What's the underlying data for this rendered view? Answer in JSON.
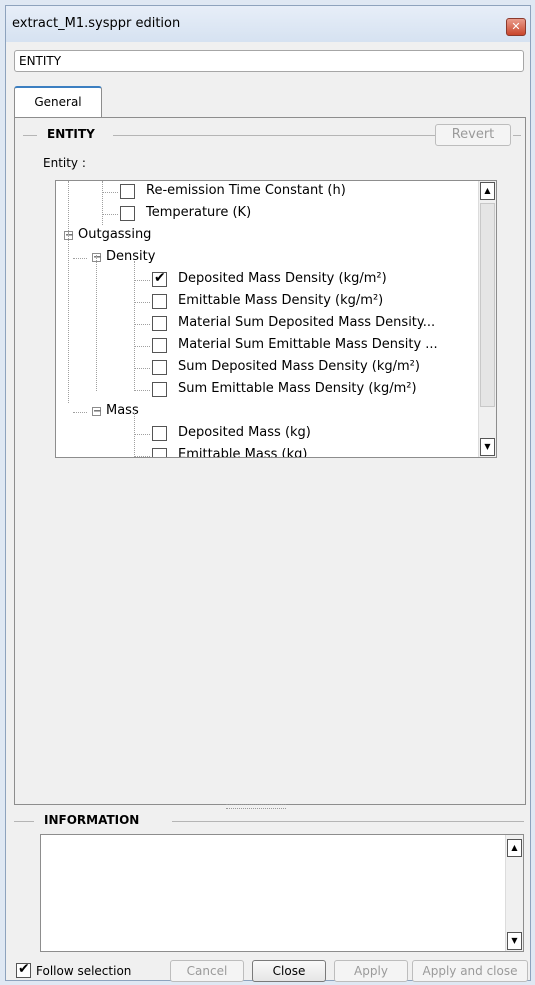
{
  "window": {
    "title": "extract_M1.sysppr edition",
    "close_glyph": "✕"
  },
  "entity_field": {
    "value": "ENTITY"
  },
  "tabs": [
    {
      "label": "General",
      "active": true
    }
  ],
  "entity_group": {
    "title": "ENTITY",
    "revert_label": "Revert",
    "entity_label": "Entity :",
    "tree": [
      {
        "label": "Re-emission Time Constant (h)",
        "type": "leaf",
        "checked": false
      },
      {
        "label": "Temperature (K)",
        "type": "leaf",
        "checked": false
      },
      {
        "label": "Outgassing",
        "type": "node",
        "expanded": true
      },
      {
        "label": "Density",
        "type": "node",
        "expanded": true
      },
      {
        "label": "Deposited Mass Density (kg/m²)",
        "type": "leaf",
        "checked": true
      },
      {
        "label": "Emittable Mass Density (kg/m²)",
        "type": "leaf",
        "checked": false
      },
      {
        "label": "Material Sum Deposited Mass Density...",
        "type": "leaf",
        "checked": false
      },
      {
        "label": "Material Sum Emittable Mass Density ...",
        "type": "leaf",
        "checked": false
      },
      {
        "label": "Sum Deposited Mass Density (kg/m²)",
        "type": "leaf",
        "checked": false
      },
      {
        "label": "Sum Emittable Mass Density (kg/m²)",
        "type": "leaf",
        "checked": false
      },
      {
        "label": "Mass",
        "type": "node",
        "expanded": true
      },
      {
        "label": "Deposited Mass (kg)",
        "type": "leaf",
        "checked": false
      },
      {
        "label": "Emittable Mass (kg)",
        "type": "leaf",
        "checked": false
      }
    ],
    "expander_glyph": "−"
  },
  "information": {
    "title": "INFORMATION"
  },
  "footer": {
    "follow_selection_label": "Follow selection",
    "follow_selection_checked": true,
    "buttons": {
      "cancel": "Cancel",
      "close": "Close",
      "apply": "Apply",
      "apply_and_close": "Apply and close"
    }
  },
  "scroll_glyphs": {
    "up": "▲",
    "down": "▼"
  }
}
